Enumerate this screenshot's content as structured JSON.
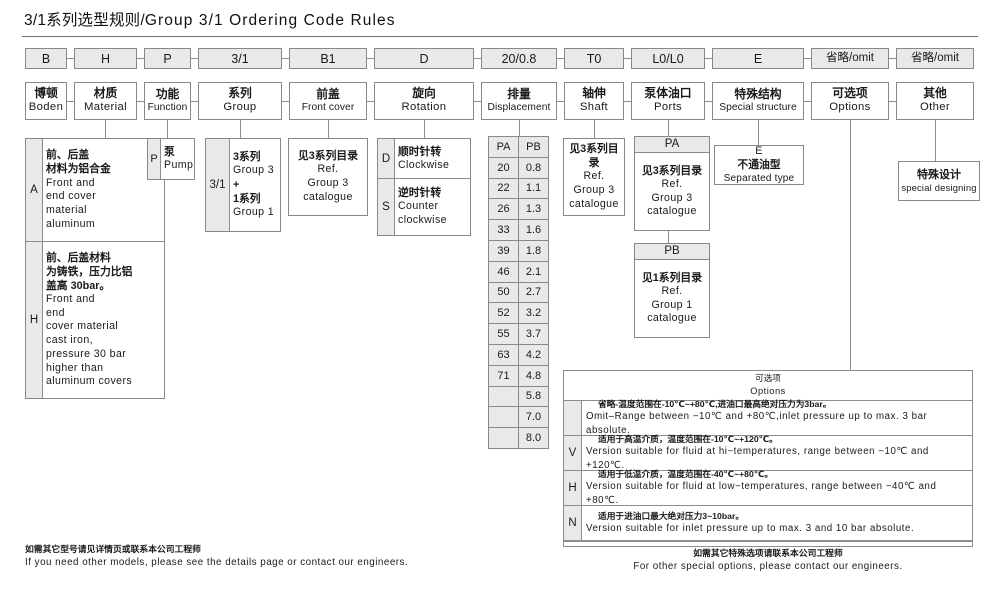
{
  "title": {
    "cn": "3/1系列选型规则/",
    "en": "Group  3/1  Ordering  Code  Rules"
  },
  "code_row": [
    {
      "label": "B"
    },
    {
      "label": "H"
    },
    {
      "label": "P"
    },
    {
      "label": "3/1"
    },
    {
      "label": "B1"
    },
    {
      "label": "D"
    },
    {
      "label": "20/0.8"
    },
    {
      "label": "T0"
    },
    {
      "label": "L0/L0"
    },
    {
      "label": "E"
    },
    {
      "label": "省略/omit"
    },
    {
      "label": "省略/omit"
    }
  ],
  "name_row": [
    {
      "cn": "博顿",
      "en": "Boden"
    },
    {
      "cn": "材质",
      "en": "Material"
    },
    {
      "cn": "功能",
      "en": "Function"
    },
    {
      "cn": "系列",
      "en": "Group"
    },
    {
      "cn": "前盖",
      "en": "Front  cover"
    },
    {
      "cn": "旋向",
      "en": "Rotation"
    },
    {
      "cn": "排量",
      "en": "Displacement"
    },
    {
      "cn": "轴伸",
      "en": "Shaft"
    },
    {
      "cn": "泵体油口",
      "en": "Ports"
    },
    {
      "cn": "特殊结构",
      "en": "Special  structure"
    },
    {
      "cn": "可选项",
      "en": "Options"
    },
    {
      "cn": "其他",
      "en": "Other"
    }
  ],
  "material": {
    "rows": [
      {
        "code": "A",
        "cn": [
          "前、后盖",
          "材料为铝合金"
        ],
        "en": [
          "Front  and",
          "end  cover",
          "material",
          "aluminum"
        ]
      },
      {
        "code": "H",
        "cn": [
          "前、后盖材料",
          "为铸铁，压力比铝",
          "盖高 30bar。"
        ],
        "en": [
          "Front  and",
          "end",
          "cover  material",
          "cast  iron,",
          "pressure  30  bar",
          "higher  than",
          "aluminum  covers"
        ]
      }
    ]
  },
  "function": {
    "code": "P",
    "cn": "泵",
    "en": "Pump"
  },
  "group": {
    "code": "3/1",
    "lines": [
      "3系列",
      "Group  3",
      "+",
      "1系列",
      "Group  1"
    ]
  },
  "front_cover": {
    "lines": [
      "见3系列目录",
      "Ref.",
      "Group  3",
      "catalogue"
    ]
  },
  "rotation": {
    "rows": [
      {
        "code": "D",
        "cn": "顺时针转",
        "en": [
          "Clockwise"
        ]
      },
      {
        "code": "S",
        "cn": "逆时针转",
        "en": [
          "Counter",
          "clockwise"
        ]
      }
    ]
  },
  "displacement": {
    "headers": [
      "PA",
      "PB"
    ],
    "rows": [
      [
        "20",
        "0.8"
      ],
      [
        "22",
        "1.1"
      ],
      [
        "26",
        "1.3"
      ],
      [
        "33",
        "1.6"
      ],
      [
        "39",
        "1.8"
      ],
      [
        "46",
        "2.1"
      ],
      [
        "50",
        "2.7"
      ],
      [
        "52",
        "3.2"
      ],
      [
        "55",
        "3.7"
      ],
      [
        "63",
        "4.2"
      ],
      [
        "71",
        "4.8"
      ],
      [
        "",
        "5.8"
      ],
      [
        "",
        "7.0"
      ],
      [
        "",
        "8.0"
      ]
    ]
  },
  "shaft": {
    "lines": [
      "见3系列目录",
      "Ref.",
      "Group  3",
      "catalogue"
    ]
  },
  "ports": {
    "pa": {
      "code": "PA",
      "lines": [
        "见3系列目录",
        "Ref.",
        "Group  3",
        "catalogue"
      ]
    },
    "pb": {
      "code": "PB",
      "lines": [
        "见1系列目录",
        "Ref.",
        "Group  1",
        "catalogue"
      ]
    }
  },
  "special_structure": {
    "code": "E",
    "cn": "不通油型",
    "en": "Separated  type"
  },
  "other": {
    "cn": "特殊设计",
    "en": "special  designing"
  },
  "options_table": {
    "head_cn": "可选项",
    "head_en": "Options",
    "rows": [
      {
        "code": "",
        "cn": "省略-温度范围在-10℃~+80℃,进油口最高绝对压力为3bar。",
        "en": "Omit–Range  between  −10℃  and  +80℃,inlet  pressure  up  to  max. 3  bar  absolute."
      },
      {
        "code": "V",
        "cn": "适用于高温介质，温度范围在-10℃~+120℃。",
        "en": "Version  suitable  for  fluid  at  hi−temperatures,  range  between  −10℃  and  +120℃."
      },
      {
        "code": "H",
        "cn": "适用于低温介质，温度范围在-40℃~+80℃。",
        "en": "Version  suitable  for  fluid  at  low−temperatures,  range  between  −40℃  and  +80℃."
      },
      {
        "code": "N",
        "cn": "适用于进油口最大绝对压力3~10bar。",
        "en": "Version  suitable  for  inlet  pressure  up  to  max. 3  and  10  bar  absolute."
      }
    ],
    "footer_cn": "如需其它特殊选项请联系本公司工程师",
    "footer_en": "For  other  special  options,  please  contact  our  engineers."
  },
  "footer_note": {
    "cn": "如需其它型号请见详情页或联系本公司工程师",
    "en": "If  you  need  other  models,  please  see  the  details  page  or  contact  our  engineers."
  },
  "colors": {
    "fill_gray": "#e9e9e9",
    "border": "#8d8d8d",
    "text": "#1a1a1a"
  }
}
